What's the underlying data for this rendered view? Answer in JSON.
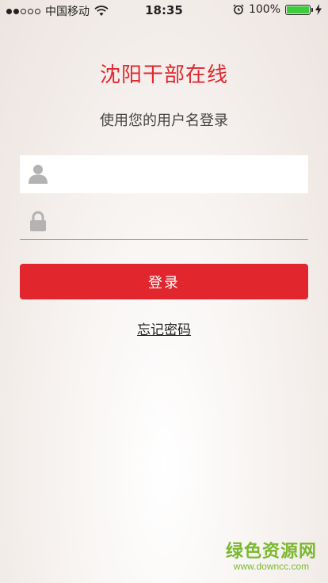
{
  "status_bar": {
    "carrier": "中国移动",
    "time": "18:35",
    "battery": "100%",
    "battery_level": 1.0,
    "wifi_icon": "wifi-icon",
    "alarm_icon": "alarm-icon",
    "charging_icon": "charging-icon"
  },
  "header": {
    "title": "沈阳干部在线",
    "subtitle": "使用您的用户名登录"
  },
  "form": {
    "username_icon": "user-icon",
    "password_icon": "lock-icon",
    "username_value": "",
    "password_value": "",
    "login_label": "登录",
    "forgot_label": "忘记密码"
  },
  "watermark": {
    "text": "绿色资源网",
    "url": "www.downcc.com"
  },
  "colors": {
    "accent": "#e1262e",
    "watermark": "#7ab82f",
    "battery": "#3ccc3c"
  }
}
